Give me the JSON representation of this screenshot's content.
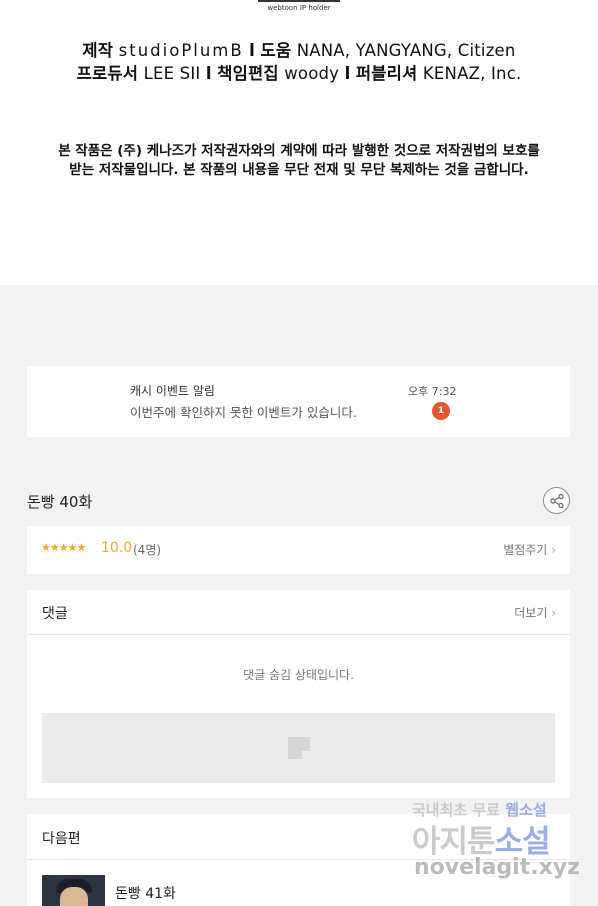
{
  "credits": {
    "holder_text": "webtoon IP holder",
    "line1": {
      "label_a": "제작",
      "value_a": "studioPlumB",
      "label_b": "도움",
      "value_b": "NANA, YANGYANG, Citizen"
    },
    "line2": {
      "label_a": "프로듀서",
      "value_a": "LEE SII",
      "label_b": "책임편집",
      "value_b": "woody",
      "label_c": "퍼블리셔",
      "value_c": "KENAZ, Inc."
    },
    "separator": "l",
    "notice_line1": "본 작품은 (주) 케나즈가 저작권자와의 계약에 따라 발행한 것으로 저작권법의 보호를",
    "notice_line2": "받는 저작물입니다. 본 작품의 내용을 무단 전재 및 무단 복제하는 것을 금합니다."
  },
  "notification": {
    "title": "캐시 이벤트 알림",
    "body": "이번주에 확인하지 못한 이벤트가 있습니다.",
    "time": "오후 7:32",
    "badge_count": "1"
  },
  "episode": {
    "title": "돈빵 40화",
    "share_icon": "share-icon"
  },
  "rating": {
    "stars": "★★★★★",
    "score": "10.0",
    "count": "(4명)",
    "rate_link": "별점주기",
    "accent_color": "#f5a623"
  },
  "comments": {
    "title": "댓글",
    "more_link": "더보기",
    "hidden_message": "댓글 숨김 상태입니다."
  },
  "next_episode": {
    "section_title": "다음편",
    "episode_title": "돈빵 41화"
  },
  "watermark": {
    "line1_a": "국내최초 무료",
    "line1_b": "웹소설",
    "line2_a": "아지툰",
    "line2_b": "소설",
    "line3": "novelagit.xyz"
  },
  "colors": {
    "badge": "#e8562f",
    "page_bg": "#f2f2f2"
  }
}
